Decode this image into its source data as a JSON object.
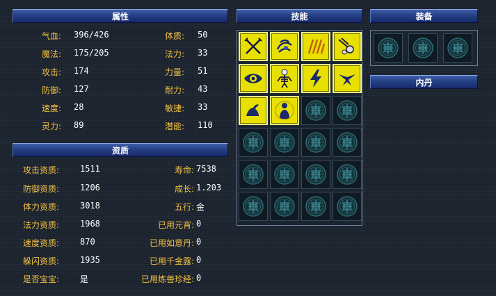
{
  "panels": {
    "attributes": {
      "title": "属性"
    },
    "aptitude": {
      "title": "资质"
    },
    "skills": {
      "title": "技能"
    },
    "equipment": {
      "title": "装备"
    },
    "neidan": {
      "title": "内丹"
    }
  },
  "attributes": {
    "left": [
      {
        "label": "气血:",
        "value": "396/426"
      },
      {
        "label": "魔法:",
        "value": "175/205"
      },
      {
        "label": "攻击:",
        "value": "174"
      },
      {
        "label": "防御:",
        "value": "127"
      },
      {
        "label": "速度:",
        "value": "28"
      },
      {
        "label": "灵力:",
        "value": "89"
      }
    ],
    "right": [
      {
        "label": "体质:",
        "value": "50"
      },
      {
        "label": "法力:",
        "value": "33"
      },
      {
        "label": "力量:",
        "value": "51"
      },
      {
        "label": "耐力:",
        "value": "43"
      },
      {
        "label": "敏捷:",
        "value": "33"
      },
      {
        "label": "潜能:",
        "value": "110"
      }
    ]
  },
  "aptitude": {
    "left": [
      {
        "label": "攻击资质:",
        "value": "1511"
      },
      {
        "label": "防御资质:",
        "value": "1206"
      },
      {
        "label": "体力资质:",
        "value": "3018"
      },
      {
        "label": "法力资质:",
        "value": "1968"
      },
      {
        "label": "速度资质:",
        "value": "870"
      },
      {
        "label": "躲闪资质:",
        "value": "1935"
      },
      {
        "label": "是否宝宝:",
        "value": "是"
      }
    ],
    "right": [
      {
        "label": "寿命:",
        "value": "7538"
      },
      {
        "label": "成长:",
        "value": "1.203"
      },
      {
        "label": "五行:",
        "value": "金"
      },
      {
        "label": "已用元宵:",
        "value": "0"
      },
      {
        "label": "已用如意丹:",
        "value": "0"
      },
      {
        "label": "已用千金露:",
        "value": "0"
      },
      {
        "label": "已用炼兽珍经:",
        "value": "0"
      }
    ]
  },
  "skills": {
    "filled": [
      "crossed-swords-icon",
      "whirlwind-icon",
      "claw-scratch-icon",
      "meteor-icon",
      "eye-icon",
      "skeleton-icon",
      "lightning-icon",
      "eagle-icon",
      "arm-strength-icon",
      "spirit-figure-icon"
    ],
    "empty_icon": "empty-slot-emblem-icon"
  },
  "equipment": {
    "slot_icon": "empty-slot-emblem-icon"
  },
  "colors": {
    "label": "#f2c040",
    "value": "#ffffff",
    "header": "#253f84",
    "skill_bg": "#e8e000"
  }
}
